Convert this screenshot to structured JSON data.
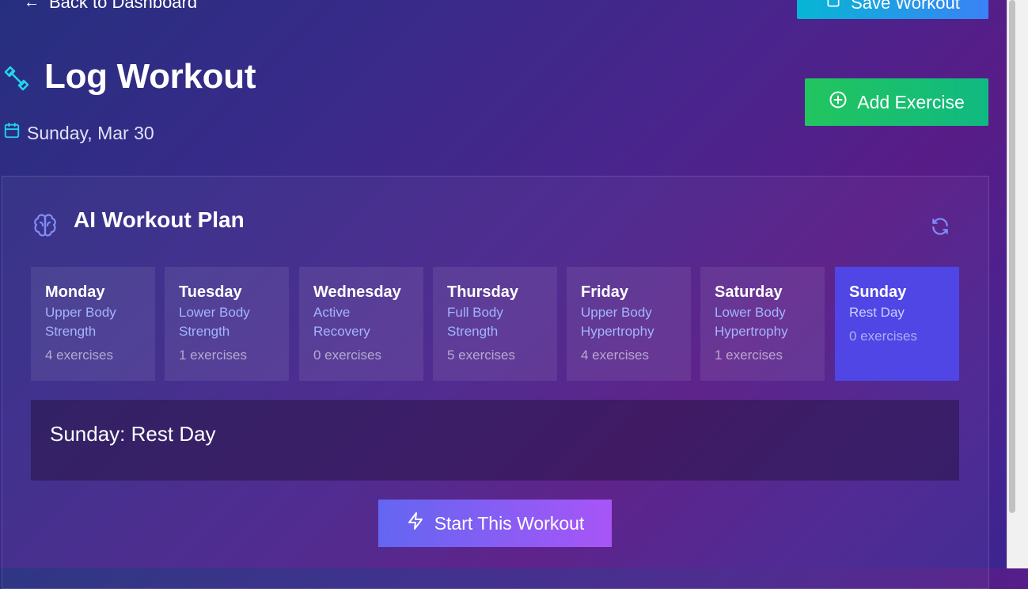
{
  "top": {
    "back_label": "Back to Dashboard",
    "save_label": "Save Workout"
  },
  "header": {
    "title": "Log Workout",
    "date": "Sunday, Mar 30",
    "add_label": "Add Exercise"
  },
  "plan": {
    "title": "AI Workout Plan",
    "days": [
      {
        "name": "Monday",
        "plan_line1": "Upper Body",
        "plan_line2": "Strength",
        "count": "4 exercises"
      },
      {
        "name": "Tuesday",
        "plan_line1": "Lower Body",
        "plan_line2": "Strength",
        "count": "1 exercises"
      },
      {
        "name": "Wednesday",
        "plan_line1": "Active",
        "plan_line2": "Recovery",
        "count": "0 exercises"
      },
      {
        "name": "Thursday",
        "plan_line1": "Full Body",
        "plan_line2": "Strength",
        "count": "5 exercises"
      },
      {
        "name": "Friday",
        "plan_line1": "Upper Body",
        "plan_line2": "Hypertrophy",
        "count": "4 exercises"
      },
      {
        "name": "Saturday",
        "plan_line1": "Lower Body",
        "plan_line2": "Hypertrophy",
        "count": "1 exercises"
      },
      {
        "name": "Sunday",
        "plan_line1": "Rest Day",
        "plan_line2": "",
        "count": "0 exercises"
      }
    ],
    "selected_day": "Sunday",
    "detail_title": "Sunday: Rest Day",
    "start_label": "Start This Workout"
  },
  "icons": {
    "title": "dumbbell-icon",
    "date": "calendar-icon",
    "add": "plus-circle-icon",
    "plan": "brain-icon",
    "refresh": "refresh-icon",
    "start": "lightning-icon",
    "back": "arrow-left-icon",
    "save": "save-icon"
  },
  "colors": {
    "add_button": "#22c55e",
    "save_button": "#06b6d4",
    "selected_day": "#4f46e5",
    "start_button_from": "#6366f1",
    "start_button_to": "#a855f7",
    "accent_icon": "#22d3ee"
  }
}
